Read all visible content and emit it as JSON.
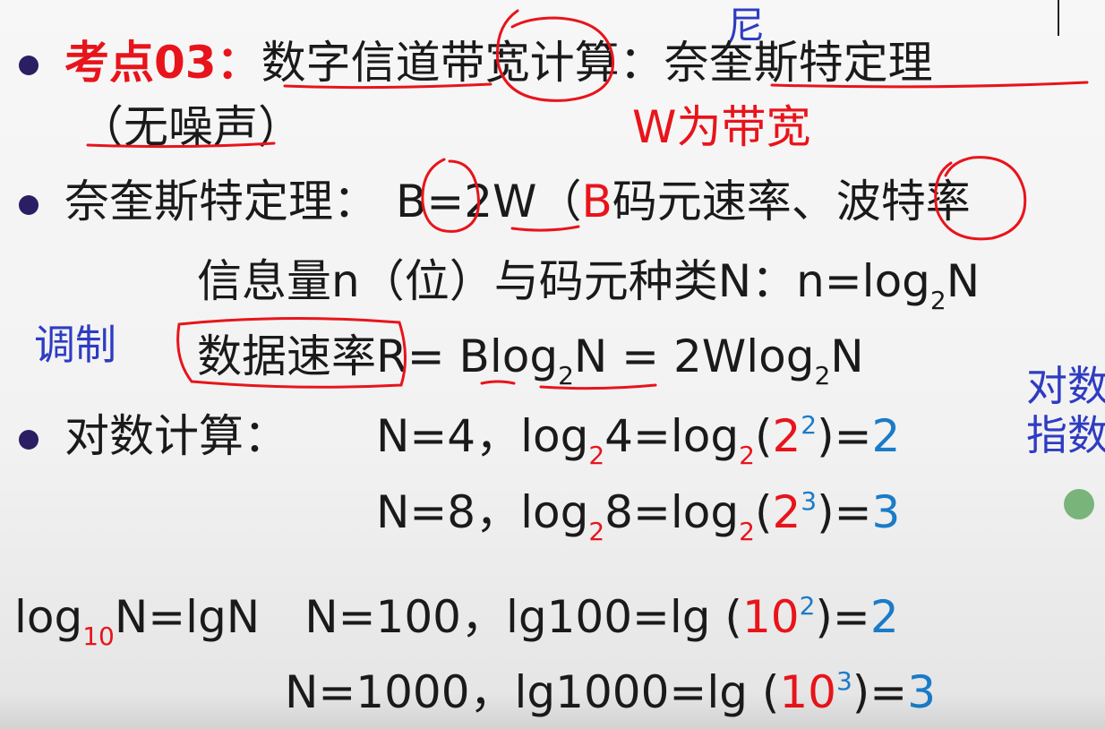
{
  "topic": {
    "label": "考点03：",
    "title": "数字信道带宽计算：奈奎斯特定理",
    "subtitle": "（无噪声）"
  },
  "annotations": {
    "ni": "尼",
    "w_is_bandwidth": "W为带宽",
    "modulation": "调制",
    "right_note_1": "对数",
    "right_note_2": "指数"
  },
  "nyquist": {
    "label": "奈奎斯特定理：",
    "formula_B": "B",
    "formula_eq": "=2W",
    "paren_open": "（",
    "symbol_B": "B",
    "baud_text": "码元速率、波特率"
  },
  "info": {
    "prefix": "信息量n（位）与码元种类N：n=log",
    "base": "2",
    "suffix": "N"
  },
  "data_rate": {
    "label": "数据速率",
    "f1": "R= Blog",
    "b1": "2",
    "f2": "N = 2Wlog",
    "b2": "2",
    "f3": "N"
  },
  "log_calc": {
    "label": "对数计算：",
    "rows": [
      {
        "n": "N=4，log",
        "base": "2",
        "mid": "4=log",
        "base2": "2",
        "open": "(",
        "pow_base": "2",
        "exp": "2",
        "close": ")=",
        "result": "2"
      },
      {
        "n": "N=8，log",
        "base": "2",
        "mid": "8=log",
        "base2": "2",
        "open": "(",
        "pow_base": "2",
        "exp": "3",
        "close": ")=",
        "result": "3"
      }
    ]
  },
  "lg": {
    "def_pre": "log",
    "def_base": "10",
    "def_post": "N=lgN",
    "rows": [
      {
        "n": "N=100，lg100=lg (",
        "pow_base": "10",
        "exp": "2",
        "close": ")=",
        "result": "2"
      },
      {
        "n": "N=1000，lg1000=lg (",
        "pow_base": "10",
        "exp": "3",
        "close": ")=",
        "result": "3"
      }
    ]
  }
}
